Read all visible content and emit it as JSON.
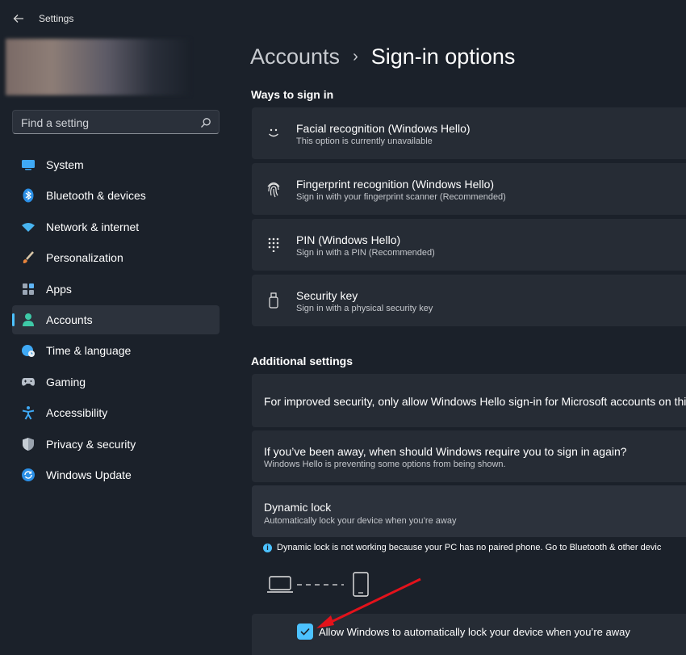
{
  "app": {
    "title": "Settings"
  },
  "search": {
    "placeholder": "Find a setting"
  },
  "sidebar": {
    "items": [
      {
        "label": "System",
        "icon": "monitor-icon",
        "active": false
      },
      {
        "label": "Bluetooth & devices",
        "icon": "bluetooth-icon",
        "active": false
      },
      {
        "label": "Network & internet",
        "icon": "wifi-icon",
        "active": false
      },
      {
        "label": "Personalization",
        "icon": "brush-icon",
        "active": false
      },
      {
        "label": "Apps",
        "icon": "apps-icon",
        "active": false
      },
      {
        "label": "Accounts",
        "icon": "person-icon",
        "active": true
      },
      {
        "label": "Time & language",
        "icon": "globe-clock-icon",
        "active": false
      },
      {
        "label": "Gaming",
        "icon": "gamepad-icon",
        "active": false
      },
      {
        "label": "Accessibility",
        "icon": "accessibility-icon",
        "active": false
      },
      {
        "label": "Privacy & security",
        "icon": "shield-icon",
        "active": false
      },
      {
        "label": "Windows Update",
        "icon": "update-icon",
        "active": false
      }
    ]
  },
  "breadcrumb": {
    "parent": "Accounts",
    "separator": "›",
    "current": "Sign-in options"
  },
  "ways": {
    "title": "Ways to sign in",
    "items": [
      {
        "title": "Facial recognition (Windows Hello)",
        "subtitle": "This option is currently unavailable",
        "icon": "face-icon"
      },
      {
        "title": "Fingerprint recognition (Windows Hello)",
        "subtitle": "Sign in with your fingerprint scanner (Recommended)",
        "icon": "fingerprint-icon"
      },
      {
        "title": "PIN (Windows Hello)",
        "subtitle": "Sign in with a PIN (Recommended)",
        "icon": "pin-keypad-icon"
      },
      {
        "title": "Security key",
        "subtitle": "Sign in with a physical security key",
        "icon": "usb-key-icon"
      }
    ]
  },
  "additional": {
    "title": "Additional settings",
    "hello_only": "For improved security, only allow Windows Hello sign-in for Microsoft accounts on this d",
    "away": {
      "title": "If you’ve been away, when should Windows require you to sign in again?",
      "subtitle": "Windows Hello is preventing some options from being shown."
    },
    "dynamic_lock": {
      "title": "Dynamic lock",
      "subtitle": "Automatically lock your device when you’re away",
      "info": "Dynamic lock is not working because your PC has no paired phone. Go to Bluetooth & other devic",
      "checkbox_label": "Allow Windows to automatically lock your device when you’re away",
      "checked": true
    }
  },
  "colors": {
    "accent": "#4cc2ff",
    "annotation_arrow": "#e3121b"
  }
}
